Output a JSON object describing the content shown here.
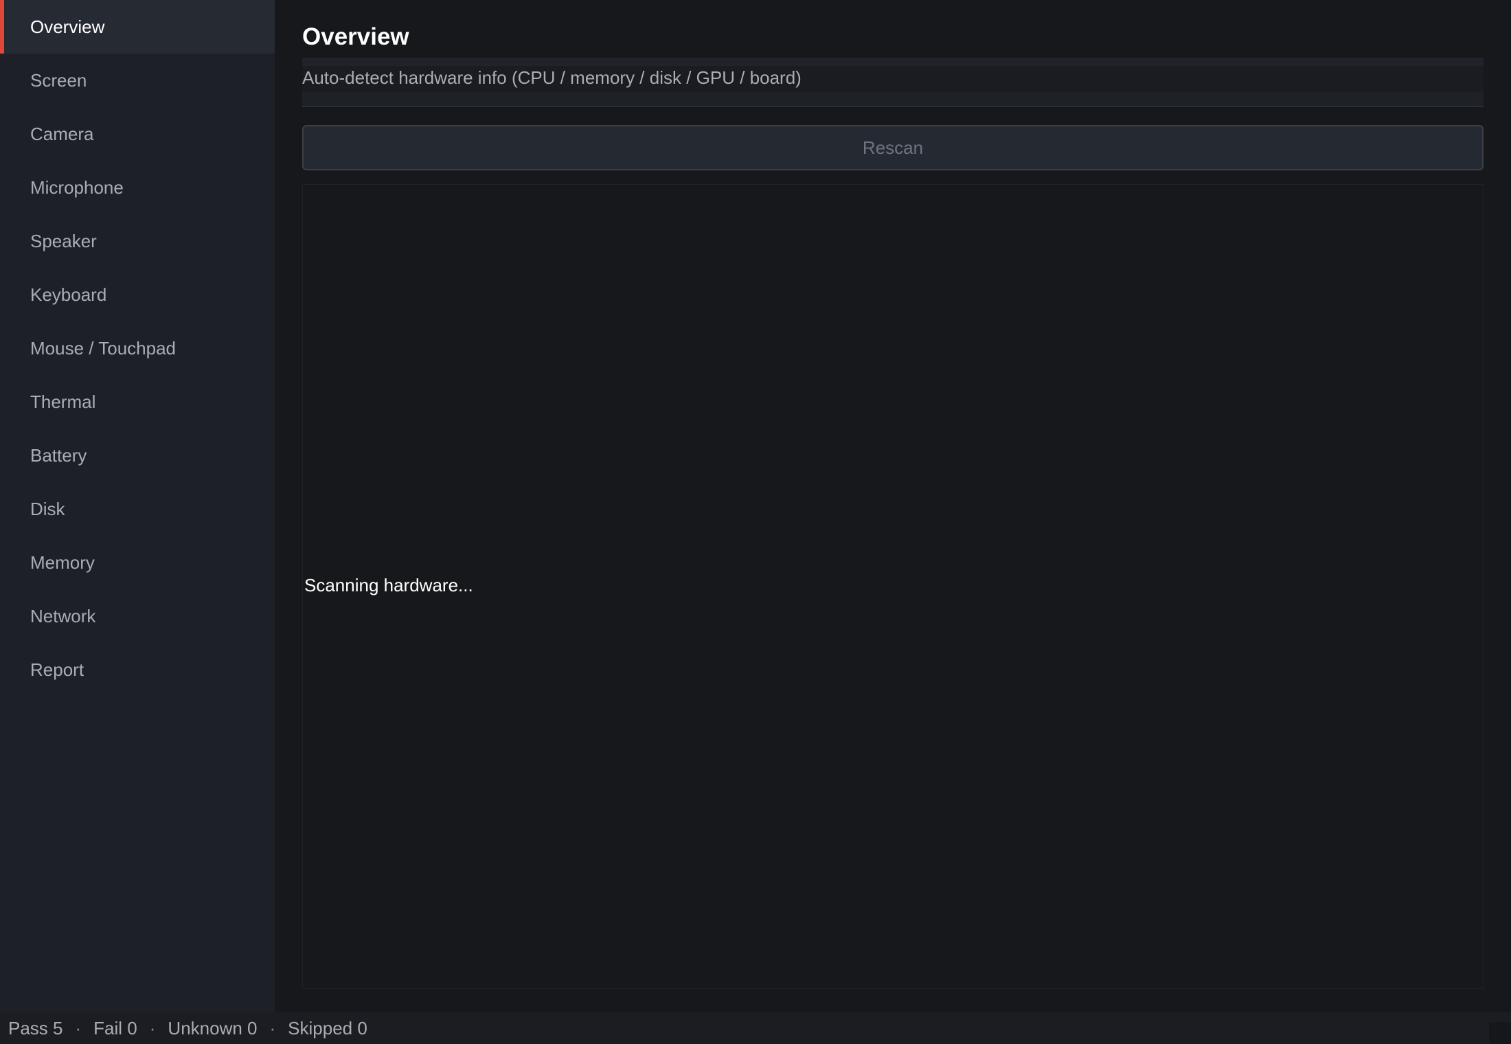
{
  "sidebar": {
    "items": [
      {
        "label": "Overview"
      },
      {
        "label": "Screen"
      },
      {
        "label": "Camera"
      },
      {
        "label": "Microphone"
      },
      {
        "label": "Speaker"
      },
      {
        "label": "Keyboard"
      },
      {
        "label": "Mouse / Touchpad"
      },
      {
        "label": "Thermal"
      },
      {
        "label": "Battery"
      },
      {
        "label": "Disk"
      },
      {
        "label": "Memory"
      },
      {
        "label": "Network"
      },
      {
        "label": "Report"
      }
    ],
    "active_index": 0
  },
  "main": {
    "title": "Overview",
    "subtitle": "Auto-detect hardware info (CPU / memory / disk / GPU / board)",
    "rescan_label": "Rescan",
    "scan_status": "Scanning hardware..."
  },
  "statusbar": {
    "pass": "Pass 5",
    "fail": "Fail 0",
    "unknown": "Unknown 0",
    "skipped": "Skipped 0",
    "separator": "·"
  },
  "colors": {
    "accent": "#e0463a",
    "sidebar_bg": "#1d2026",
    "main_bg": "#16181c",
    "active_item_bg": "#262a33"
  }
}
